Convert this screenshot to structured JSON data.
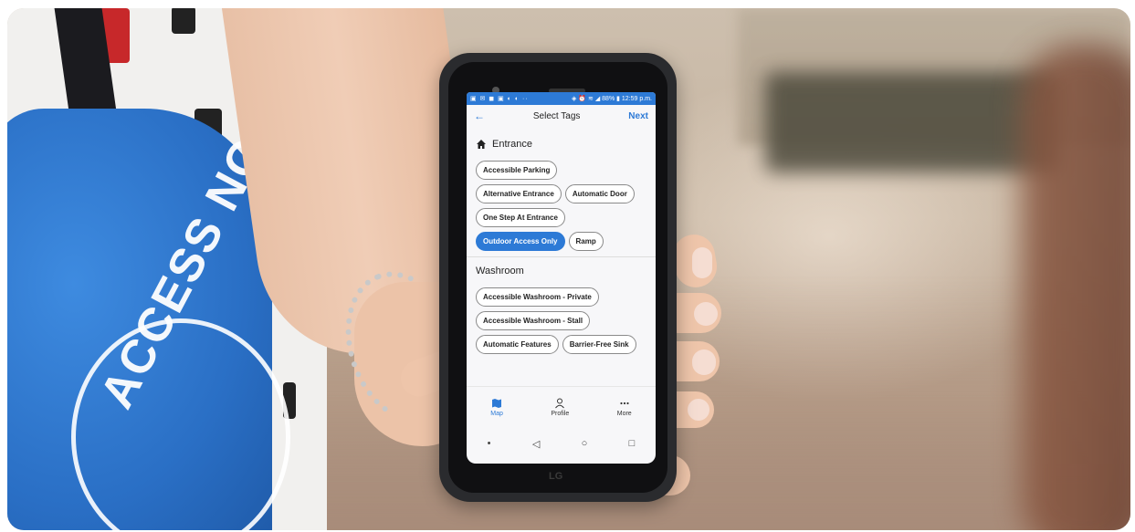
{
  "status_bar": {
    "right": "◈ ⏰ ≋ ◢ 88% ▮ 12:59 p.m."
  },
  "app_bar": {
    "title": "Select Tags",
    "next_label": "Next"
  },
  "sections": {
    "entrance": {
      "title": "Entrance",
      "tags": [
        "Accessible Parking",
        "Alternative Entrance",
        "Automatic Door",
        "One Step At Entrance",
        "Outdoor Access Only",
        "Ramp"
      ],
      "selected": "Outdoor Access Only"
    },
    "washroom": {
      "title": "Washroom",
      "tags": [
        "Accessible Washroom - Private",
        "Accessible Washroom - Stall",
        "Automatic Features",
        "Barrier-Free Sink"
      ]
    }
  },
  "bottom_nav": {
    "map": "Map",
    "profile": "Profile",
    "more": "More",
    "active": "Map"
  },
  "bag_text": "ACCESS NOW",
  "phone_brand": "LG",
  "colors": {
    "accent": "#2d7ad6",
    "bag_blue": "#2a6fc5"
  }
}
